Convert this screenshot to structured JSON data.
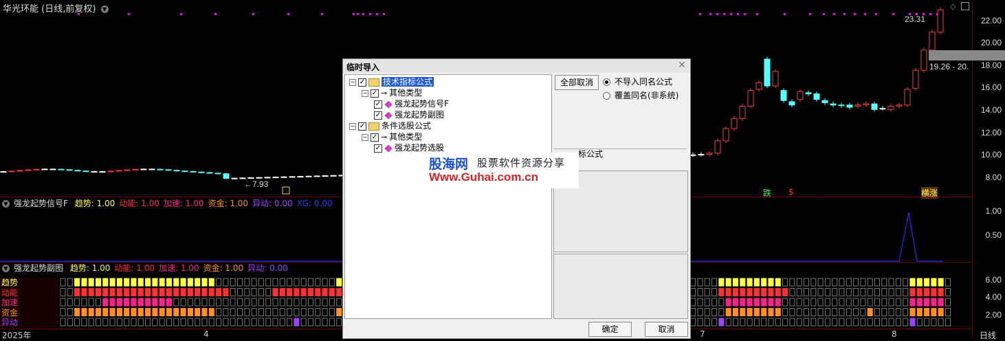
{
  "header": {
    "title": "华光环能 (日线,前复权)"
  },
  "main_chart": {
    "y_axis_ticks": [
      "22.00",
      "20.00",
      "18.00",
      "16.00",
      "14.00",
      "12.00",
      "10.00",
      "8.00"
    ],
    "low_marker": "←7.93",
    "high_marker": "23.31",
    "range_label": "19.26 - 20.",
    "signal_labels": [
      "跌",
      "$",
      "横涨"
    ],
    "colors": {
      "up": "#ff3c3c",
      "down": "#54ffff",
      "flat": "#ffffff",
      "dots": "#ff00ff"
    }
  },
  "indicator1": {
    "name": "强龙起势信号F",
    "items": [
      {
        "label": "趋势: 1.00",
        "color": "#ffff40"
      },
      {
        "label": "动能: 1.00",
        "color": "#ff3030"
      },
      {
        "label": "加速: 1.00",
        "color": "#ff2090"
      },
      {
        "label": "资金: 1.00",
        "color": "#ff9020"
      },
      {
        "label": "异动: 0.00",
        "color": "#a040ff"
      },
      {
        "label": "XG: 0.00",
        "color": "#2040ff"
      }
    ],
    "y_axis_ticks": [
      "1.00",
      "0.50"
    ]
  },
  "indicator2": {
    "name": "强龙起势副图",
    "items": [
      {
        "label": "趋势: 1.00",
        "color": "#ffff40"
      },
      {
        "label": "动能: 1.00",
        "color": "#ff3030"
      },
      {
        "label": "加速: 1.00",
        "color": "#ff2090"
      },
      {
        "label": "资金: 1.00",
        "color": "#ff9020"
      },
      {
        "label": "异动: 0.00",
        "color": "#a040ff"
      }
    ],
    "row_labels": [
      {
        "label": "趋势",
        "color": "#ffff40"
      },
      {
        "label": "动能",
        "color": "#ff3030"
      },
      {
        "label": "加速",
        "color": "#ff2090"
      },
      {
        "label": "资金",
        "color": "#ff9020"
      },
      {
        "label": "异动",
        "color": "#a040ff"
      }
    ],
    "y_axis_ticks": [
      "6.00",
      "4.00",
      "2.00"
    ]
  },
  "time_axis": {
    "labels": [
      "2025年",
      "4",
      "7",
      "8"
    ],
    "period": "日线"
  },
  "dialog": {
    "title": "临时导入",
    "tree": [
      {
        "label": "技术指标公式",
        "level": 0,
        "type": "folder",
        "selected": true
      },
      {
        "label": "其他类型",
        "level": 1,
        "type": "key"
      },
      {
        "label": "强龙起势信号F",
        "level": 2,
        "type": "formula"
      },
      {
        "label": "强龙起势副图",
        "level": 2,
        "type": "formula"
      },
      {
        "label": "条件选股公式",
        "level": 0,
        "type": "folder"
      },
      {
        "label": "其他类型",
        "level": 1,
        "type": "key"
      },
      {
        "label": "强龙起势选股",
        "level": 2,
        "type": "formula"
      }
    ],
    "deselect_all": "全部取消",
    "radio_options": [
      "不导入同名公式",
      "覆盖同名(非系统)"
    ],
    "section_label_partial": "标公式",
    "ok": "确定",
    "cancel": "取消"
  },
  "watermark": {
    "line1a": "股海网",
    "line1b": "股票软件资源分享",
    "line2": "Www.Guhai.com.cn"
  }
}
